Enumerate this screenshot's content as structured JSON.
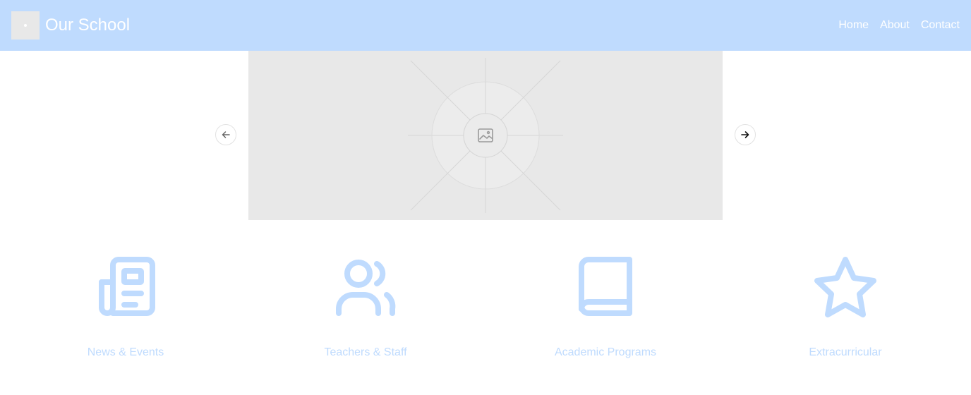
{
  "header": {
    "title": "Our School",
    "logo_icon": "image-placeholder-icon",
    "background": "#bfdbfe",
    "nav": [
      {
        "label": "Home"
      },
      {
        "label": "About"
      },
      {
        "label": "Contact"
      }
    ]
  },
  "carousel": {
    "image_icon": "image-icon",
    "prev_icon": "arrow-left-icon",
    "next_icon": "arrow-right-icon"
  },
  "features": [
    {
      "label": "News & Events",
      "icon": "newspaper-icon"
    },
    {
      "label": "Teachers & Staff",
      "icon": "users-icon"
    },
    {
      "label": "Academic Programs",
      "icon": "book-icon"
    },
    {
      "label": "Extracurricular",
      "icon": "star-icon"
    }
  ],
  "colors": {
    "accent": "#bfdbfe",
    "placeholder": "#e8e8e8"
  }
}
